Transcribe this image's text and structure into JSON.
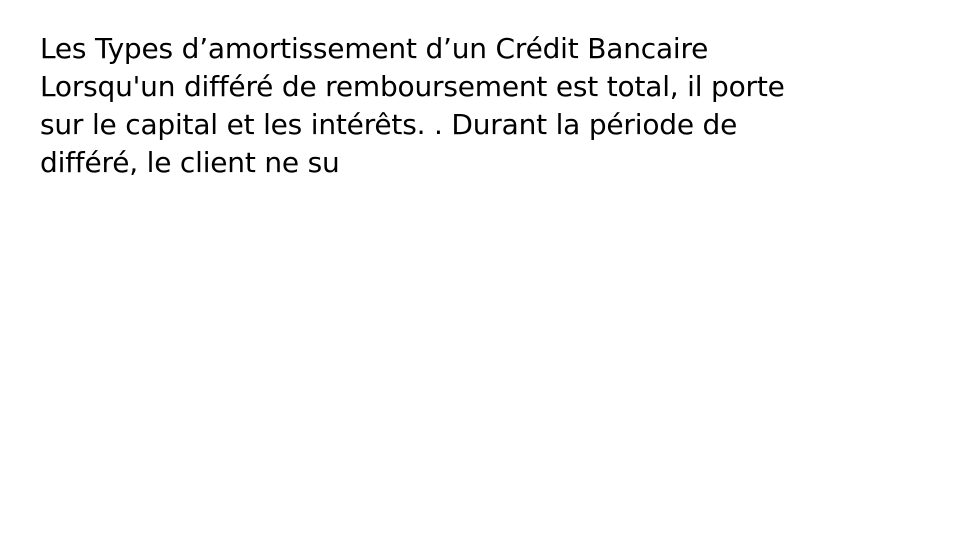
{
  "slide": {
    "title": "Les Types d’amortissement d’un Crédit Bancaire",
    "body_lines": [
      "Lorsqu'un différé de remboursement est total, il porte",
      "sur le capital et les intérêts. . Durant la période de",
      "différé, le client ne su"
    ],
    "text_color": "#000000",
    "background_color": "#ffffff"
  }
}
